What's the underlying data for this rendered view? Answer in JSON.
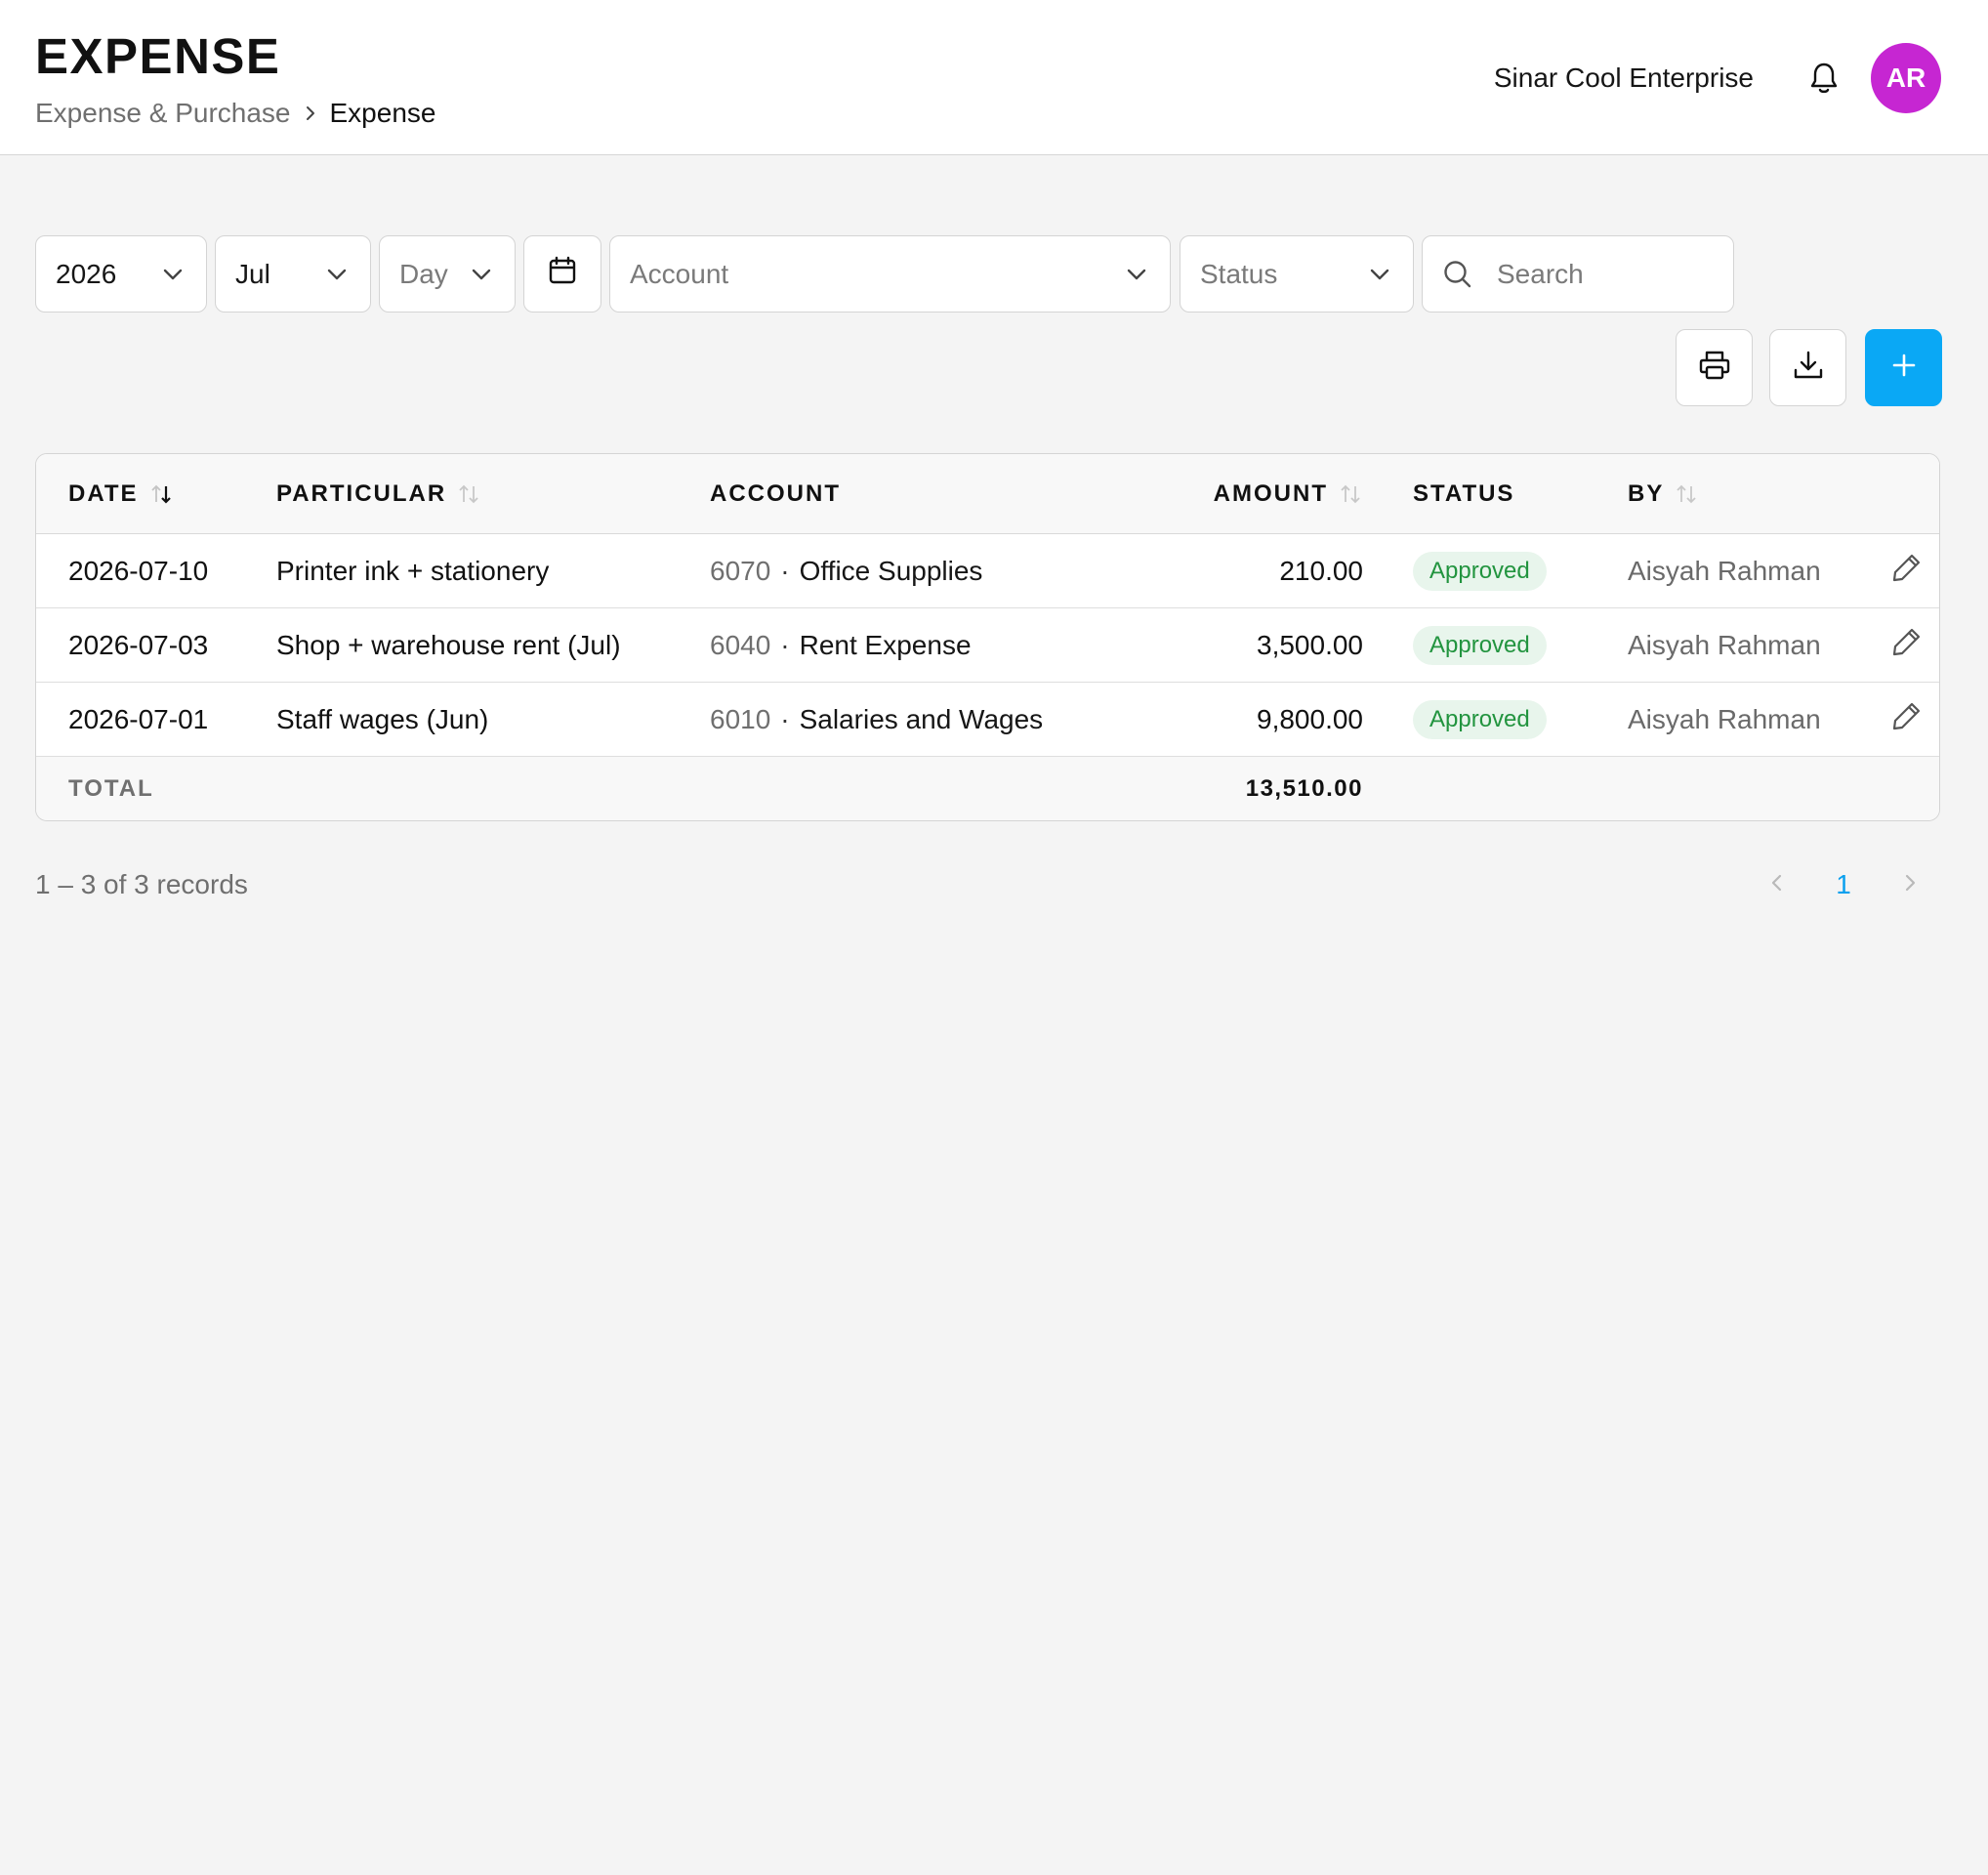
{
  "header": {
    "title": "EXPENSE",
    "breadcrumb": {
      "parent": "Expense & Purchase",
      "current": "Expense"
    },
    "company": "Sinar Cool Enterprise",
    "avatar_initials": "AR",
    "avatar_color": "#c626d2"
  },
  "filters": {
    "year": "2026",
    "month": "Jul",
    "day_placeholder": "Day",
    "account_placeholder": "Account",
    "status_placeholder": "Status",
    "search_placeholder": "Search"
  },
  "actions": {
    "print_icon": "printer-icon",
    "download_icon": "download-icon",
    "add_icon": "plus-icon",
    "accent_color": "#0aa8f5"
  },
  "table": {
    "columns": {
      "date": "DATE",
      "particular": "PARTICULAR",
      "account": "ACCOUNT",
      "amount": "AMOUNT",
      "status": "STATUS",
      "by": "BY"
    },
    "rows": [
      {
        "date": "2026-07-10",
        "particular": "Printer ink + stationery",
        "account_code": "6070",
        "account_name": "Office Supplies",
        "amount": "210.00",
        "status": "Approved",
        "by": "Aisyah Rahman"
      },
      {
        "date": "2026-07-03",
        "particular": "Shop + warehouse rent (Jul)",
        "account_code": "6040",
        "account_name": "Rent Expense",
        "amount": "3,500.00",
        "status": "Approved",
        "by": "Aisyah Rahman"
      },
      {
        "date": "2026-07-01",
        "particular": "Staff wages (Jun)",
        "account_code": "6010",
        "account_name": "Salaries and Wages",
        "amount": "9,800.00",
        "status": "Approved",
        "by": "Aisyah Rahman"
      }
    ],
    "account_separator": "·",
    "total_label": "TOTAL",
    "total_amount": "13,510.00",
    "status_color": "#22943f"
  },
  "pagination": {
    "records_text": "1 – 3 of 3 records",
    "current_page": "1",
    "page_color": "#0aa0ee"
  }
}
